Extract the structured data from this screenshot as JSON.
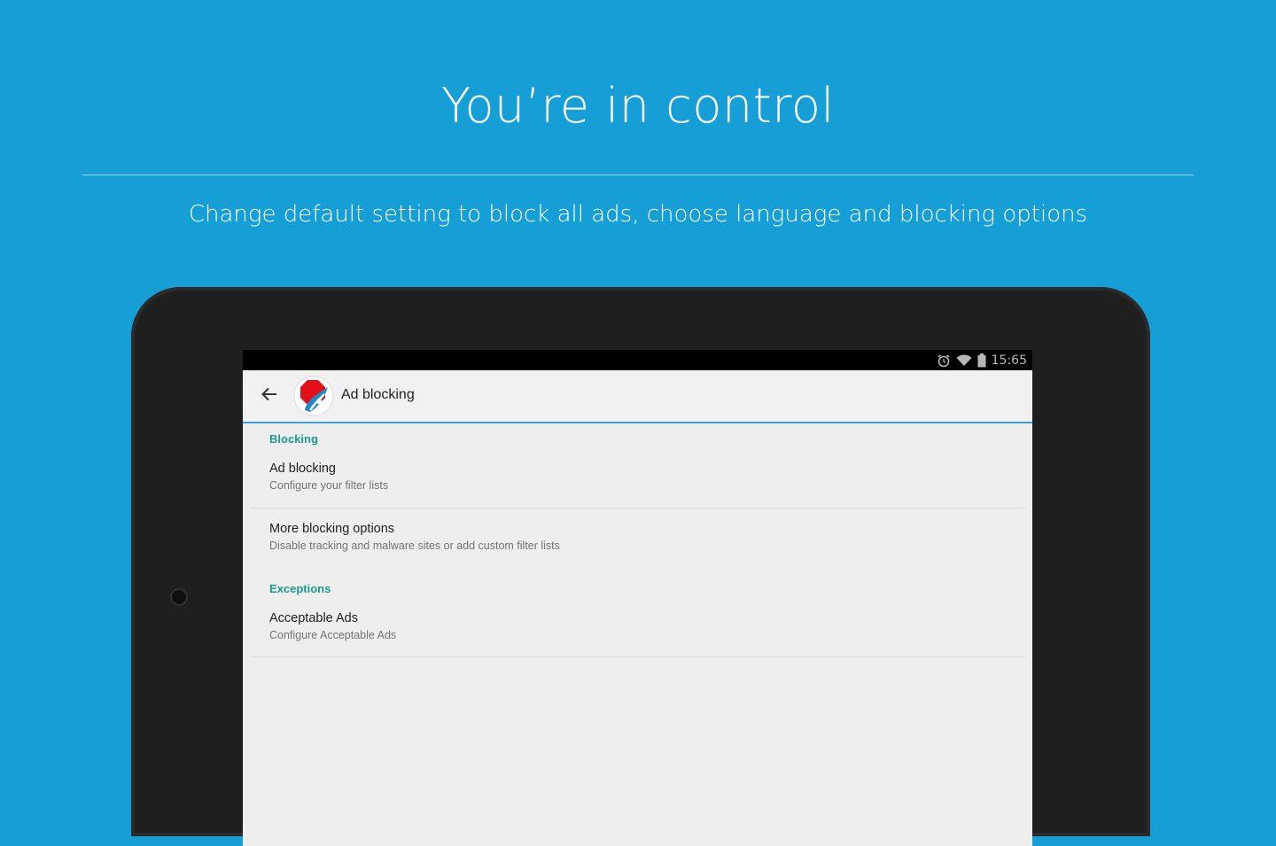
{
  "promo": {
    "headline": "You’re in control",
    "subline": "Change default setting to block all ads, choose language and blocking options"
  },
  "status_bar": {
    "time": "15:65",
    "icons": [
      "alarm-icon",
      "wifi-icon",
      "battery-icon"
    ]
  },
  "app_bar": {
    "back_icon": "arrow-back-icon",
    "logo_icon": "adblock-browser-logo-icon",
    "title": "Ad blocking"
  },
  "sections": [
    {
      "header": "Blocking",
      "items": [
        {
          "title": "Ad blocking",
          "summary": "Configure your filter lists"
        },
        {
          "title": "More blocking options",
          "summary": "Disable tracking and malware sites or add custom filter lists"
        }
      ]
    },
    {
      "header": "Exceptions",
      "items": [
        {
          "title": "Acceptable Ads",
          "summary": "Configure Acceptable Ads"
        }
      ]
    }
  ],
  "colors": {
    "background": "#159fd6",
    "accent_teal": "#1a9b8e",
    "app_bar_underline": "#3aa1d4",
    "logo_red": "#e3101a",
    "logo_blue": "#1e88c8"
  }
}
